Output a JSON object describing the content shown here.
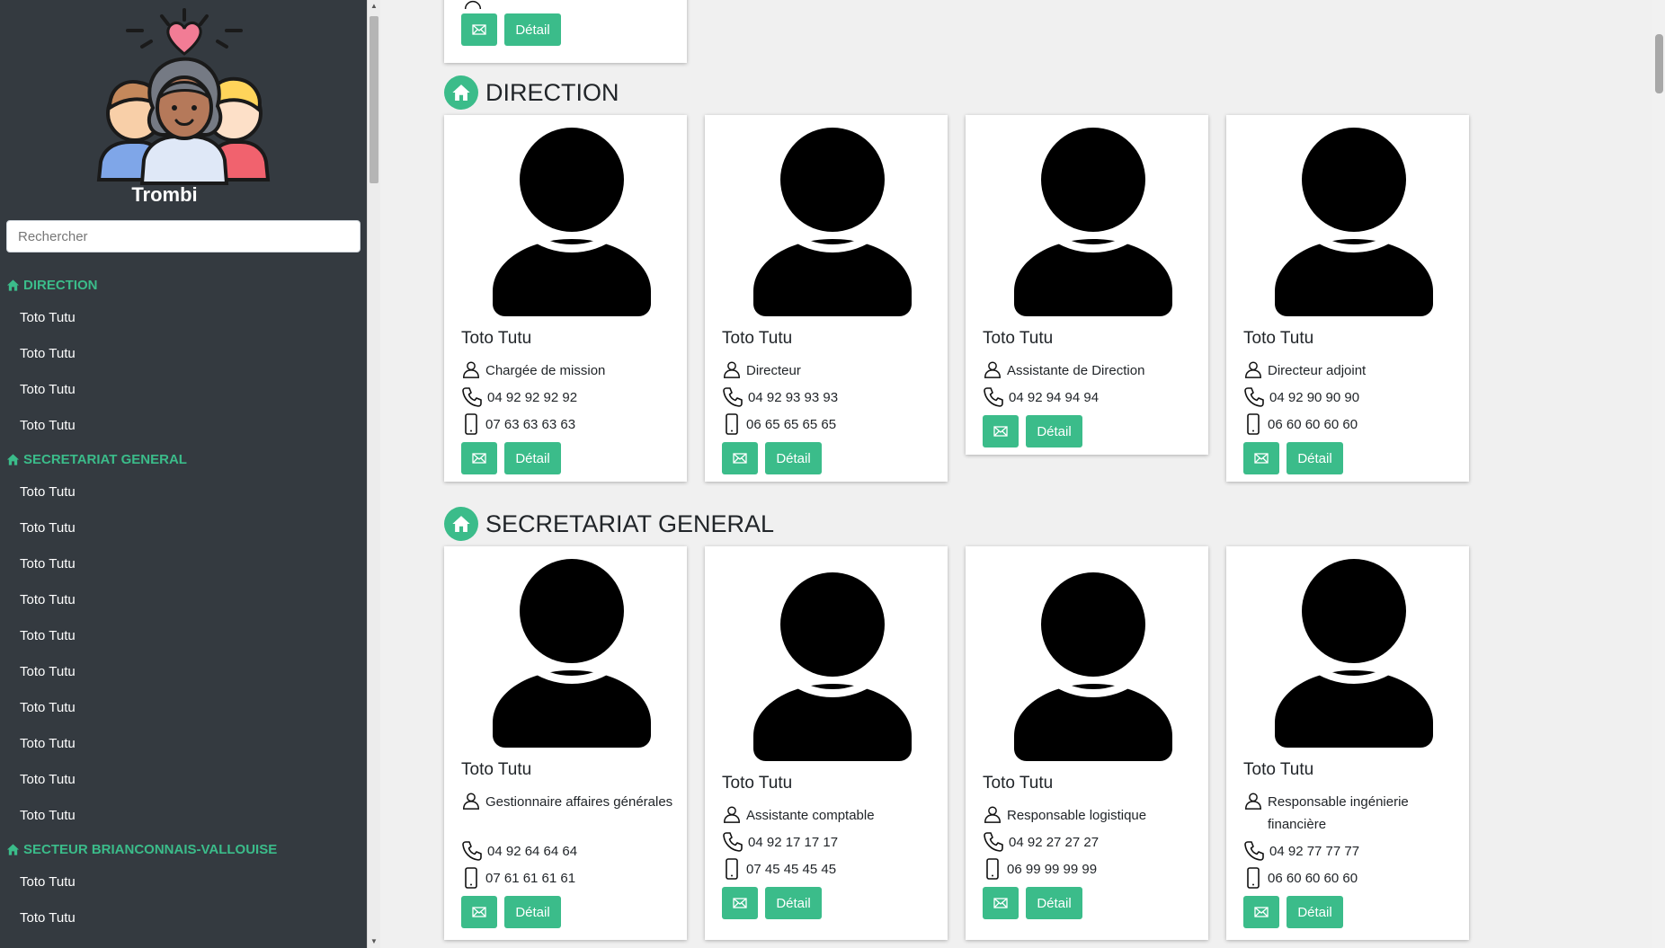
{
  "app": {
    "brand": "Trombi"
  },
  "search": {
    "placeholder": "Rechercher"
  },
  "sidebar": {
    "sections": [
      {
        "label": "DIRECTION",
        "items": [
          "Toto Tutu",
          "Toto Tutu",
          "Toto Tutu",
          "Toto Tutu"
        ]
      },
      {
        "label": "SECRETARIAT GENERAL",
        "items": [
          "Toto Tutu",
          "Toto Tutu",
          "Toto Tutu",
          "Toto Tutu",
          "Toto Tutu",
          "Toto Tutu",
          "Toto Tutu",
          "Toto Tutu",
          "Toto Tutu",
          "Toto Tutu"
        ]
      },
      {
        "label": "SECTEUR BRIANCONNAIS-VALLOUISE",
        "items": [
          "Toto Tutu",
          "Toto Tutu"
        ]
      }
    ]
  },
  "colors": {
    "accent": "#3bbc8a",
    "sidebar_bg": "#343a40",
    "page_bg": "#f0f0f0"
  },
  "buttons": {
    "detail_label": "Détail"
  },
  "main": {
    "sections": [
      {
        "title": "DIRECTION",
        "cards": [
          {
            "name": "Toto Tutu",
            "role": "Chargée de mission",
            "phone": "04 92 92 92 92",
            "mobile": "07 63 63 63 63"
          },
          {
            "name": "Toto Tutu",
            "role": "Directeur",
            "phone": "04 92 93 93 93",
            "mobile": "06 65 65 65 65"
          },
          {
            "name": "Toto Tutu",
            "role": "Assistante de Direction",
            "phone": "04 92 94 94 94"
          },
          {
            "name": "Toto Tutu",
            "role": "Directeur adjoint",
            "phone": "04 92 90 90 90",
            "mobile": "06 60 60 60 60"
          }
        ]
      },
      {
        "title": "SECRETARIAT GENERAL",
        "cards": [
          {
            "name": "Toto Tutu",
            "role": "Gestionnaire affaires générales",
            "phone": "04 92 64 64 64",
            "mobile": "07 61 61 61 61"
          },
          {
            "name": "Toto Tutu",
            "role": "Assistante comptable",
            "phone": "04 92 17 17 17",
            "mobile": "07 45 45 45 45"
          },
          {
            "name": "Toto Tutu",
            "role": "Responsable logistique",
            "phone": "04 92 27 27 27",
            "mobile": "06 99 99 99 99"
          },
          {
            "name": "Toto Tutu",
            "role": "Responsable ingénierie financière",
            "phone": "04 92 77 77 77",
            "mobile": "06 60 60 60 60"
          }
        ]
      }
    ]
  }
}
